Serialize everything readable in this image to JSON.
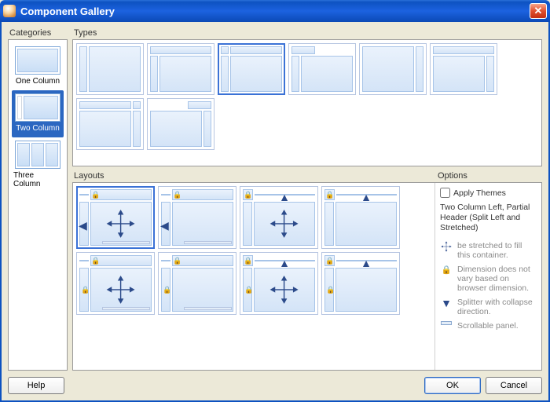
{
  "title": "Component Gallery",
  "labels": {
    "categories": "Categories",
    "types": "Types",
    "layouts": "Layouts",
    "options": "Options"
  },
  "categories": [
    {
      "label": "One Column"
    },
    {
      "label": "Two Column"
    },
    {
      "label": "Three Column"
    }
  ],
  "selectedCategoryIndex": 1,
  "selectedTypeIndex": 2,
  "selectedLayoutIndex": 0,
  "options": {
    "apply_themes": "Apply Themes",
    "description": "Two Column Left, Partial Header (Split Left and Stretched)",
    "legend": {
      "stretch": "be stretched to fill this container.",
      "lock": "Dimension does not vary based on browser dimension.",
      "splitter": "Splitter with collapse direction.",
      "scroll": "Scrollable panel."
    }
  },
  "buttons": {
    "help": "Help",
    "ok": "OK",
    "cancel": "Cancel"
  }
}
